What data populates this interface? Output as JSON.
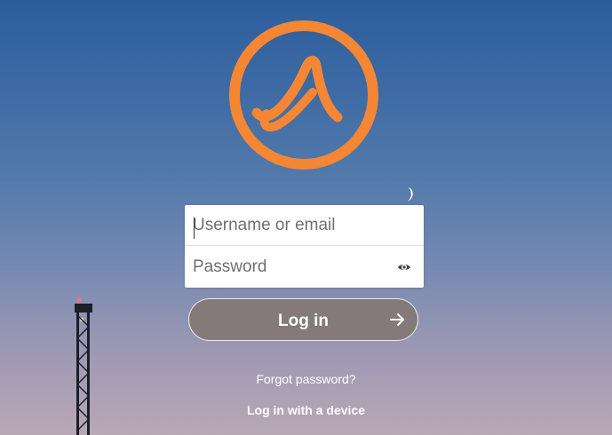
{
  "logo": {
    "icon": "app-logo-icon",
    "color": "#f58634"
  },
  "login_form": {
    "username": {
      "placeholder": "Username or email",
      "value": ""
    },
    "password": {
      "placeholder": "Password",
      "value": "",
      "toggle_icon": "eye-icon"
    }
  },
  "actions": {
    "login_label": "Log in",
    "login_icon": "arrow-right-icon",
    "forgot_password": "Forgot password?",
    "login_with_device": "Log in with a device"
  },
  "theme": {
    "button_color": "#857a7a",
    "text_color": "#ffffff"
  }
}
